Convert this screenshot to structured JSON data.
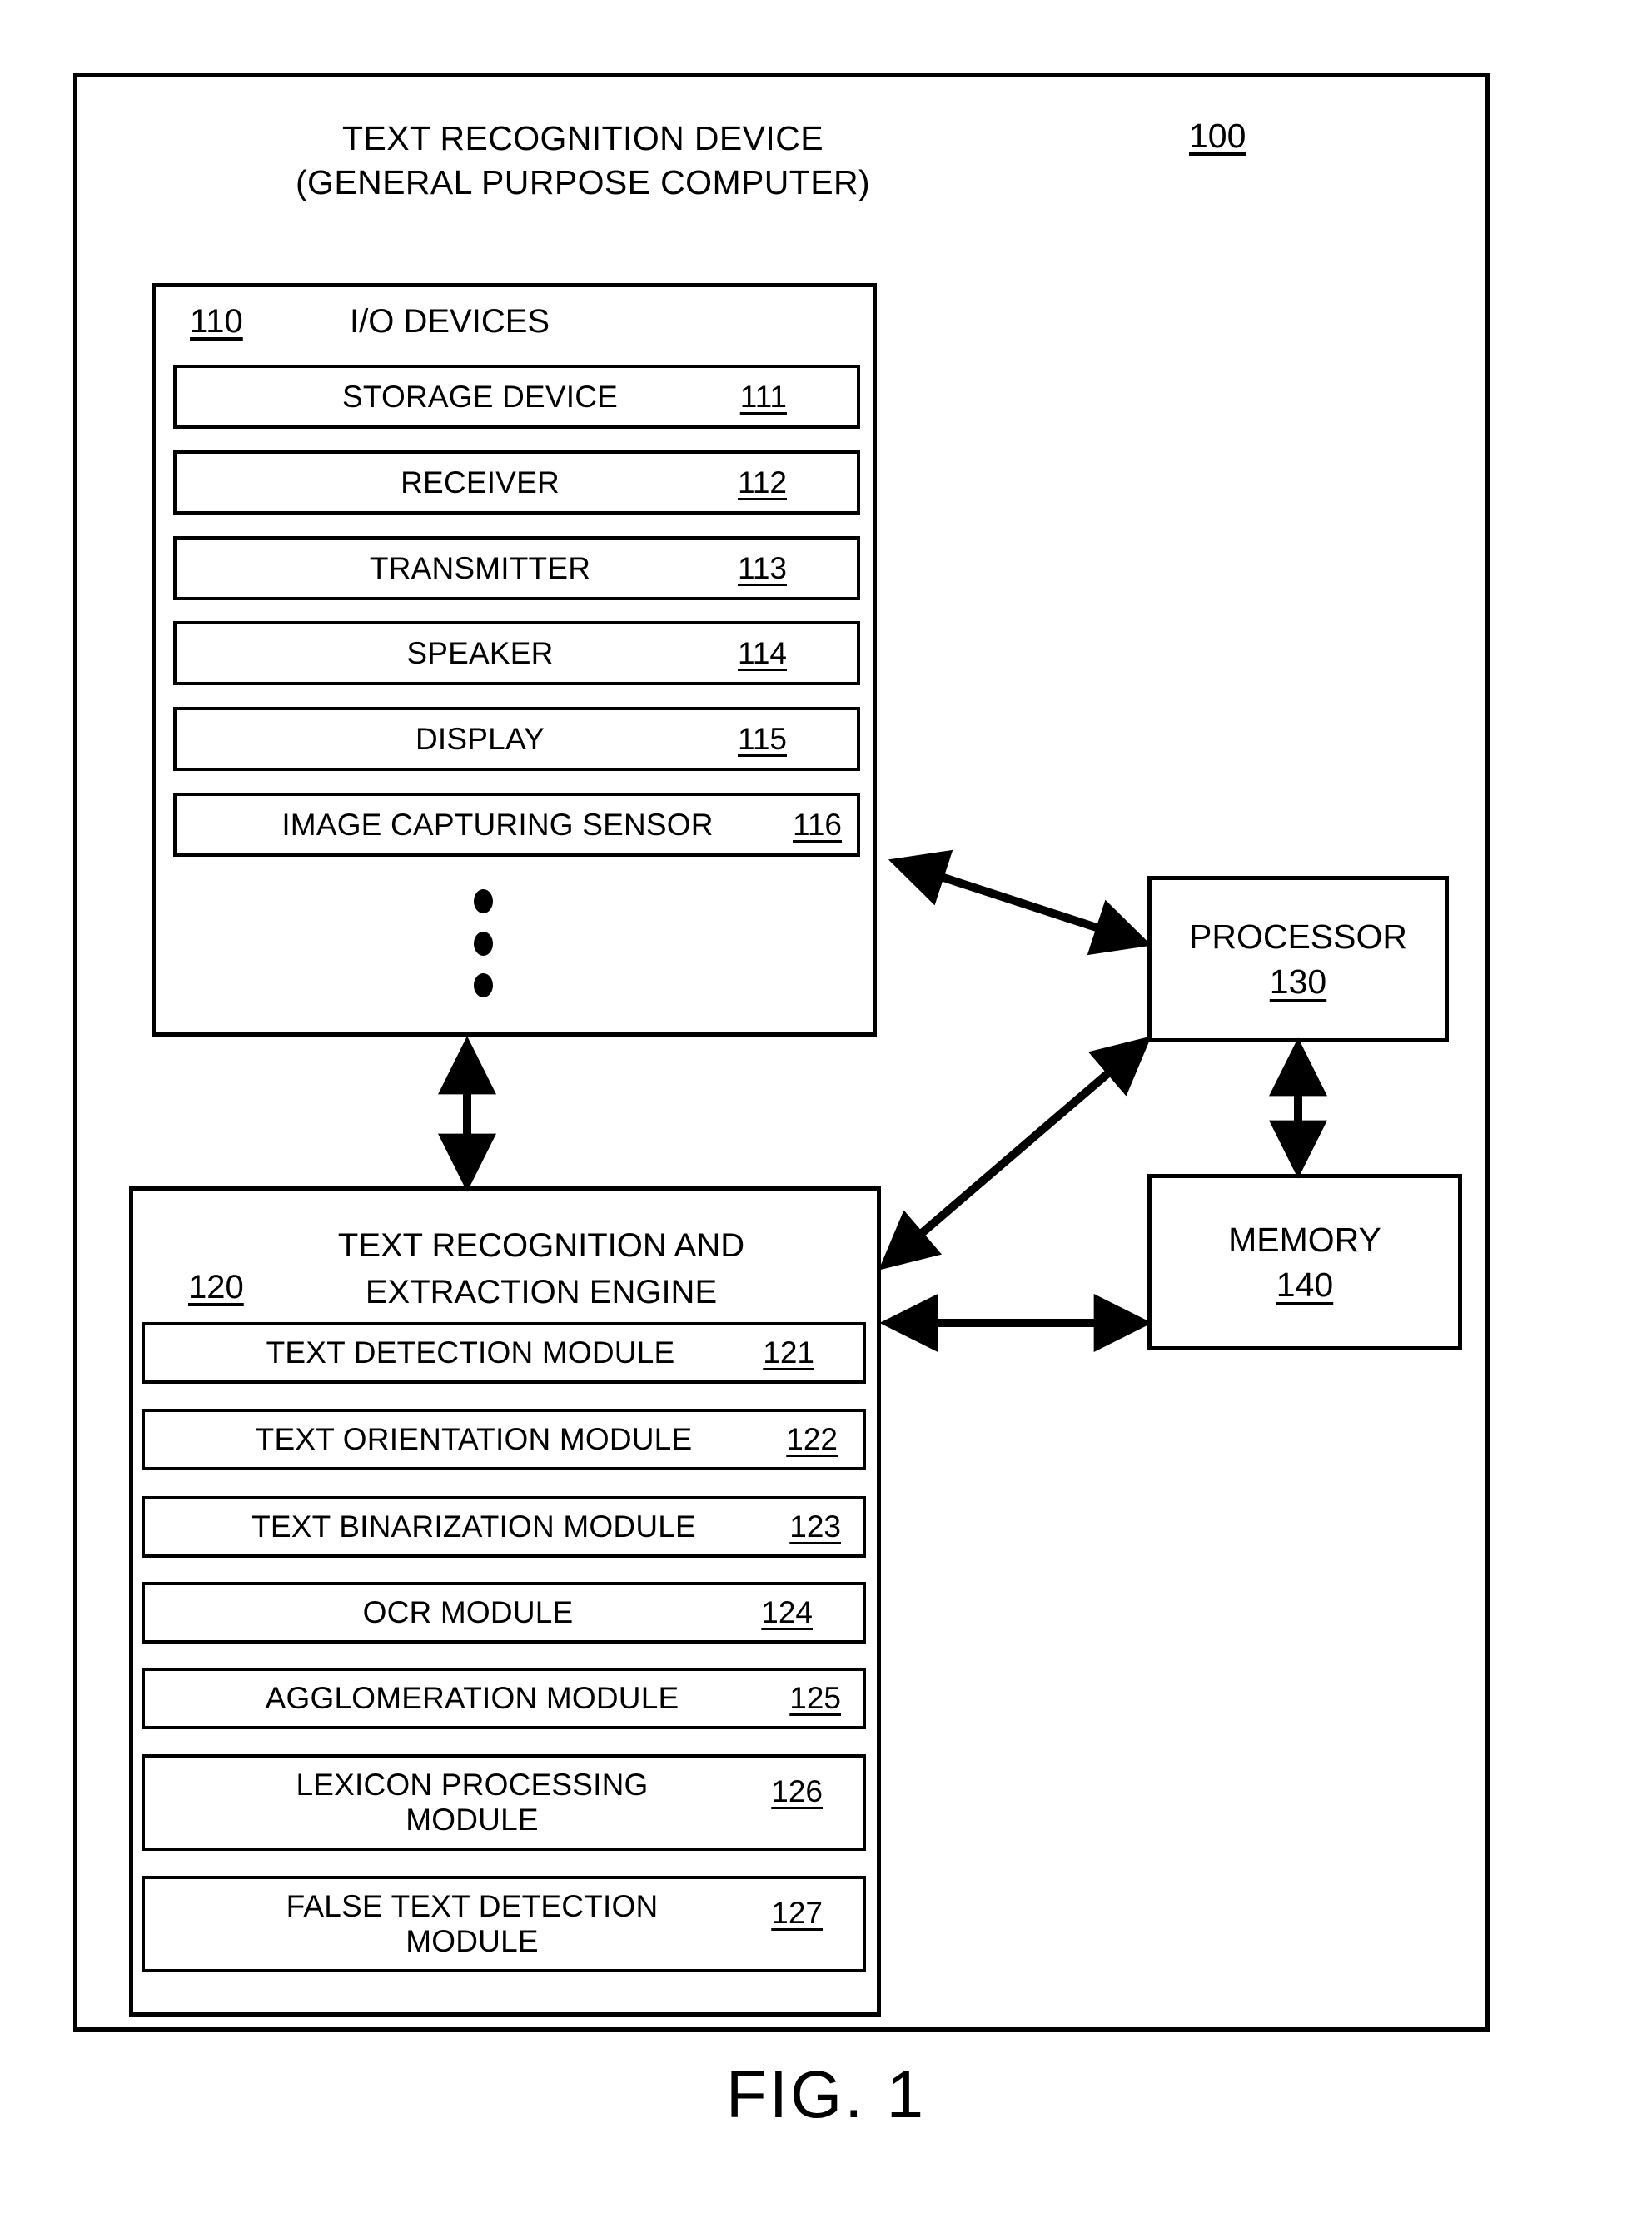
{
  "figure": {
    "caption": "FIG. 1",
    "reference_numeral": "100"
  },
  "device": {
    "title": "TEXT RECOGNITION DEVICE\n(GENERAL PURPOSE COMPUTER)"
  },
  "io_devices": {
    "ref": "110",
    "title": "I/O DEVICES",
    "items": [
      {
        "label": "STORAGE DEVICE",
        "ref": "111"
      },
      {
        "label": "RECEIVER",
        "ref": "112"
      },
      {
        "label": "TRANSMITTER",
        "ref": "113"
      },
      {
        "label": "SPEAKER",
        "ref": "114"
      },
      {
        "label": "DISPLAY",
        "ref": "115"
      },
      {
        "label": "IMAGE CAPTURING SENSOR",
        "ref": "116"
      }
    ],
    "continuation_indicator": "vertical-ellipsis"
  },
  "engine": {
    "ref": "120",
    "title": "TEXT RECOGNITION AND\nEXTRACTION ENGINE",
    "modules": [
      {
        "label": "TEXT DETECTION MODULE",
        "ref": "121"
      },
      {
        "label": "TEXT ORIENTATION MODULE",
        "ref": "122"
      },
      {
        "label": "TEXT BINARIZATION MODULE",
        "ref": "123"
      },
      {
        "label": "OCR MODULE",
        "ref": "124"
      },
      {
        "label": "AGGLOMERATION  MODULE",
        "ref": "125"
      },
      {
        "label": "LEXICON PROCESSING\nMODULE",
        "ref": "126"
      },
      {
        "label": "FALSE TEXT DETECTION\nMODULE",
        "ref": "127"
      }
    ]
  },
  "processor": {
    "label": "PROCESSOR",
    "ref": "130"
  },
  "memory": {
    "label": "MEMORY",
    "ref": "140"
  },
  "connections": [
    {
      "from": "io_devices",
      "to": "processor",
      "type": "bidirectional"
    },
    {
      "from": "io_devices",
      "to": "engine",
      "type": "bidirectional"
    },
    {
      "from": "engine",
      "to": "processor",
      "type": "bidirectional"
    },
    {
      "from": "engine",
      "to": "memory",
      "type": "bidirectional"
    },
    {
      "from": "processor",
      "to": "memory",
      "type": "bidirectional"
    }
  ],
  "colors": {
    "ink": "#000000",
    "paper": "#ffffff"
  }
}
